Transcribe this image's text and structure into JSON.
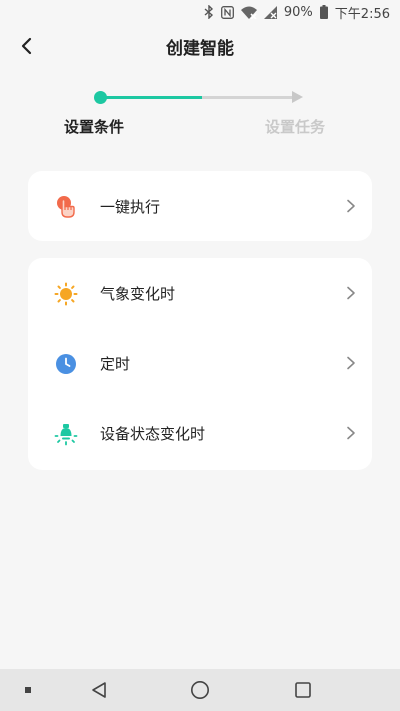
{
  "status_bar": {
    "battery": "90%",
    "time": "下午2:56"
  },
  "header": {
    "title": "创建智能",
    "back_icon": "chevron-left-icon"
  },
  "stepper": {
    "steps": [
      {
        "label": "设置条件",
        "state": "active"
      },
      {
        "label": "设置任务",
        "state": "inactive"
      }
    ],
    "active_color": "#1dc8a2",
    "inactive_color": "#d4d4d4"
  },
  "cards": [
    {
      "items": [
        {
          "label": "一键执行",
          "icon": "tap-hand-icon",
          "icon_color": "#f26a4b"
        }
      ]
    },
    {
      "items": [
        {
          "label": "气象变化时",
          "icon": "sun-icon",
          "icon_color": "#f6a623"
        },
        {
          "label": "定时",
          "icon": "clock-icon",
          "icon_color": "#4a90e2"
        },
        {
          "label": "设备状态变化时",
          "icon": "device-bulb-icon",
          "icon_color": "#1dc8a2"
        }
      ]
    }
  ],
  "nav_bar": {
    "items": [
      "menu-dot-icon",
      "back-triangle-icon",
      "home-circle-icon",
      "recents-square-icon"
    ]
  }
}
